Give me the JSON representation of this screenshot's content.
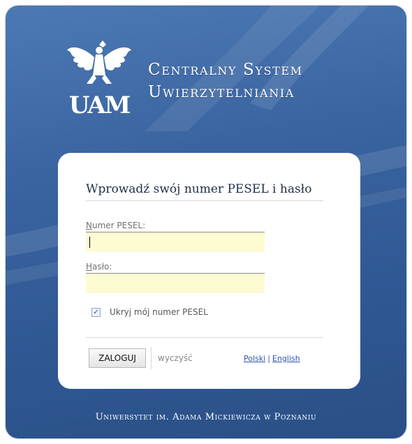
{
  "header": {
    "logo_text": "UAM",
    "title_line1": "Centralny System",
    "title_line2": "Uwierzytelniania"
  },
  "form": {
    "heading": "Wprowadź swój numer PESEL i hasło",
    "pesel_label_access_key": "N",
    "pesel_label_rest": "umer PESEL:",
    "pesel_value": "",
    "password_label_access_key": "H",
    "password_label_rest": "asło:",
    "password_value": "",
    "hide_pesel_label": "Ukryj mój numer PESEL",
    "hide_pesel_checked": true,
    "login_button": "ZALOGUJ",
    "clear_link": "wyczyść",
    "languages": [
      "Polski",
      "English"
    ],
    "language_separator": "|"
  },
  "footer": {
    "text": "Uniwersytet im. Adama Mickiewicza w Poznaniu"
  },
  "colors": {
    "background_blue": "#3a64a0",
    "input_background": "#fdfbd2",
    "link_blue": "#2b55a8"
  },
  "icons": {
    "logo": "uam-eagle-logo",
    "checkbox": "checkmark-icon"
  }
}
